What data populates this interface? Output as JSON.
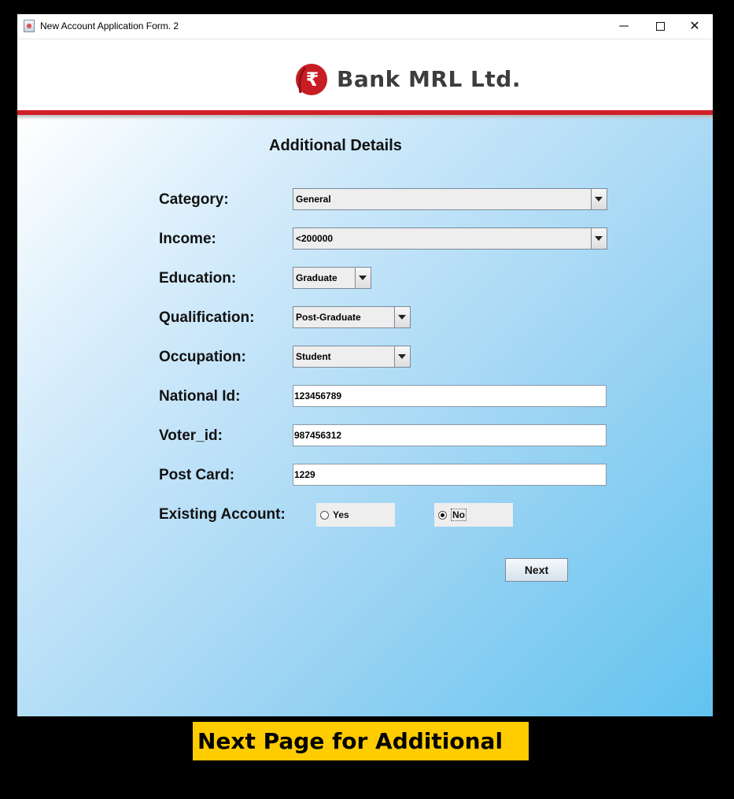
{
  "window": {
    "title": "New Account Application Form. 2",
    "controls": {
      "minimize": "─",
      "close": "✕"
    }
  },
  "header": {
    "brand": "Bank MRL Ltd.",
    "logo_icon": "rupee-logo-icon",
    "logo_symbol": "₹",
    "accent_color": "#d11f27"
  },
  "form": {
    "heading": "Additional Details",
    "category": {
      "label": "Category:",
      "value": "General"
    },
    "income": {
      "label": "Income:",
      "value": "<200000"
    },
    "education": {
      "label": "Education:",
      "value": "Graduate"
    },
    "qualification": {
      "label": "Qualification:",
      "value": "Post-Graduate"
    },
    "occupation": {
      "label": "Occupation:",
      "value": "Student"
    },
    "national_id": {
      "label": "National Id:",
      "value": "123456789"
    },
    "voter_id": {
      "label": "Voter_id:",
      "value": "987456312"
    },
    "post_card": {
      "label": "Post Card:",
      "value": "1229"
    },
    "existing_account": {
      "label": "Existing Account:",
      "options": [
        "Yes",
        "No"
      ],
      "selected": "No"
    },
    "next_label": "Next"
  },
  "caption": "Next Page for Additional info"
}
